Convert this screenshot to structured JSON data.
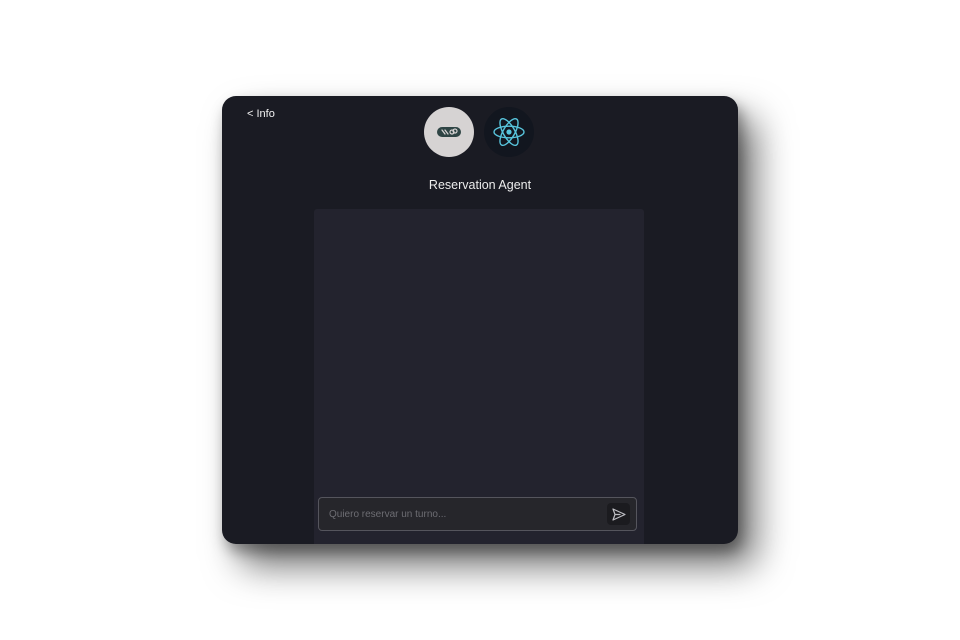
{
  "header": {
    "back_label": "< Info",
    "title": "Reservation Agent"
  },
  "logos": [
    {
      "icon": "link-icon",
      "background": "#d6d3d3"
    },
    {
      "icon": "react-icon",
      "background": "#12161f",
      "color": "#58c4dc"
    }
  ],
  "chat": {
    "messages": [],
    "input": {
      "value": "",
      "placeholder": "Quiero reservar un turno..."
    },
    "send_icon": "send-icon"
  },
  "colors": {
    "card_bg": "#1a1b23",
    "panel_bg": "#23232e",
    "react_accent": "#58c4dc"
  }
}
